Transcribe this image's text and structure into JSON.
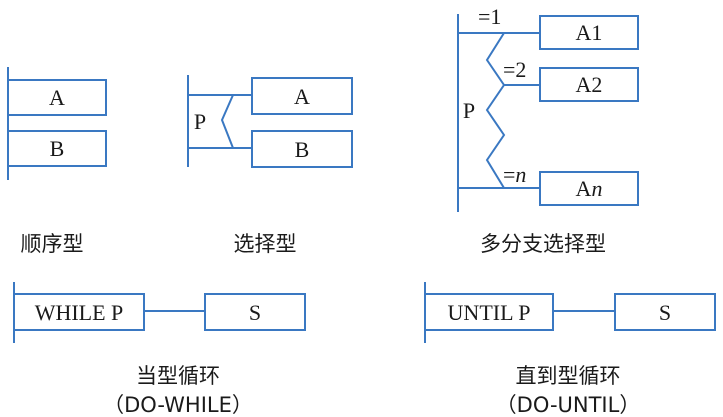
{
  "colors": {
    "line": "#3a78c2",
    "text": "#1a1a1a"
  },
  "sequence": {
    "box1": "A",
    "box2": "B",
    "caption": "顺序型"
  },
  "selection": {
    "condition": "P",
    "box1": "A",
    "box2": "B",
    "caption": "选择型"
  },
  "multi_branch": {
    "condition": "P",
    "branch1_label": "=1",
    "branch1_box": "A1",
    "branch2_label": "=2",
    "branch2_box": "A2",
    "branchn_label": "=",
    "branchn_var": "n",
    "branchn_box_prefix": "A",
    "branchn_box_var": "n",
    "caption": "多分支选择型"
  },
  "do_while": {
    "cond_text": "WHILE  P",
    "body": "S",
    "caption": "当型循环",
    "subcaption": "（DO-WHILE）"
  },
  "do_until": {
    "cond_text": "UNTIL  P",
    "body": "S",
    "caption": "直到型循环",
    "subcaption": "（DO-UNTIL）"
  }
}
